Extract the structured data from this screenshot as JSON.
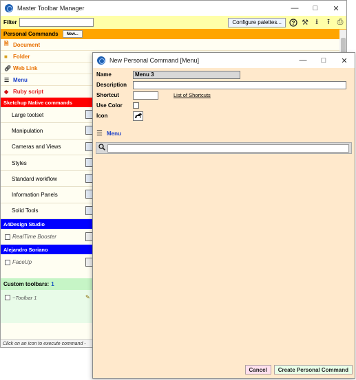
{
  "main_window": {
    "title": "Master Toolbar Manager",
    "filter_label": "Filter",
    "filter_value": "",
    "configure_label": "Configure palettes...",
    "personal_header": "Personal Commands",
    "new_label": "New...",
    "personal_items": [
      {
        "label": "Document",
        "icon": "document-icon"
      },
      {
        "label": "Folder",
        "icon": "folder-icon"
      },
      {
        "label": "Web Link",
        "icon": "link-icon"
      },
      {
        "label": "Menu",
        "icon": "hamburger-icon"
      },
      {
        "label": "Ruby script",
        "icon": "ruby-icon"
      }
    ],
    "native_header": "Sketchup Native commands",
    "native_items": [
      "Large toolset",
      "Manipulation",
      "Cameras and Views",
      "Styles",
      "Standard workflow",
      "Information Panels",
      "Solid Tools"
    ],
    "a4_header": "A4Design Studio",
    "a4_item": "RealTime Booster",
    "alejandro_header": "Alejandro Soriano",
    "alejandro_item": "FaceUp",
    "custom_header": "Custom toolbars:",
    "custom_count": "1",
    "custom_item": "~Toolbar 1",
    "status": "Click on an icon to execute command -"
  },
  "dialog": {
    "title": "New Personal Command [Menu]",
    "name_label": "Name",
    "name_value": "Menu 3",
    "description_label": "Description",
    "description_value": "",
    "shortcut_label": "Shortcut",
    "shortcut_value": "",
    "shortcuts_link": "List of Shortcuts",
    "use_color_label": "Use Color",
    "icon_label": "Icon",
    "menu_label": "Menu",
    "search_value": "",
    "cancel_label": "Cancel",
    "create_label": "Create Personal Command"
  },
  "colors": {
    "orange": "#ffa500",
    "red": "#ff0000",
    "blue": "#0000ff",
    "green": "#c6f5c6",
    "dialog_bg": "#ffe9cc"
  }
}
